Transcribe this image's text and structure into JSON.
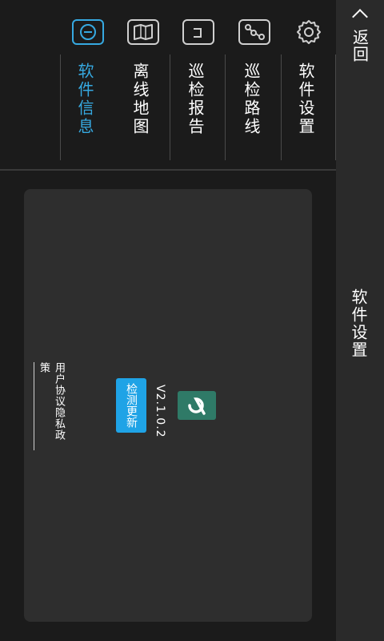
{
  "header": {
    "back_label": "返回",
    "title": "软件设置"
  },
  "tabs": [
    {
      "label": "软件设置",
      "icon": "gear-icon"
    },
    {
      "label": "巡检路线",
      "icon": "route-icon"
    },
    {
      "label": "巡检报告",
      "icon": "report-icon"
    },
    {
      "label": "离线地图",
      "icon": "map-book-icon"
    },
    {
      "label": "软件信息",
      "icon": "info-icon",
      "active": true
    }
  ],
  "info": {
    "version": "V2.1.0.2",
    "check_update": "检测更新",
    "user_agreement": "用户协议",
    "privacy_policy": "隐私政策"
  },
  "colors": {
    "accent": "#36a9e1",
    "button": "#1fa3e6",
    "logo": "#2f7a67"
  }
}
